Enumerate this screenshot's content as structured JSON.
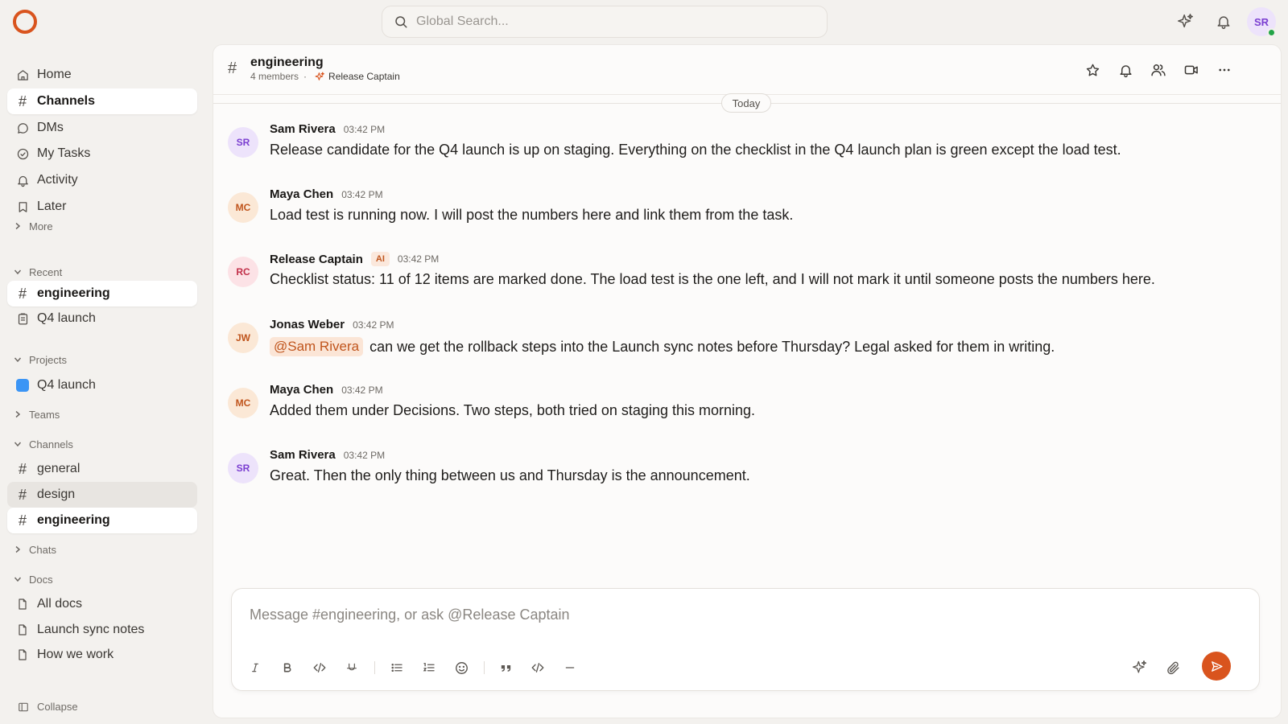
{
  "app": {
    "search_placeholder": "Global Search...",
    "user_initials": "SR",
    "accent": "#d9541e"
  },
  "sidebar": {
    "nav": [
      {
        "label": "Home",
        "icon": "home-icon"
      },
      {
        "label": "Channels",
        "icon": "hash-icon",
        "active": true
      },
      {
        "label": "DMs",
        "icon": "chat-bubble-icon"
      },
      {
        "label": "My Tasks",
        "icon": "check-circle-icon"
      },
      {
        "label": "Activity",
        "icon": "bell-icon"
      },
      {
        "label": "Later",
        "icon": "bookmark-icon"
      }
    ],
    "more_label": "More",
    "recent_label": "Recent",
    "recent": [
      {
        "label": "engineering",
        "icon": "hash-icon",
        "active": true
      },
      {
        "label": "Q4 launch",
        "icon": "clipboard-icon"
      }
    ],
    "projects_label": "Projects",
    "projects": [
      {
        "label": "Q4 launch",
        "color": "#3b95f5"
      }
    ],
    "teams_label": "Teams",
    "channels_label": "Channels",
    "channels": [
      {
        "label": "general"
      },
      {
        "label": "design",
        "hover": true
      },
      {
        "label": "engineering",
        "active": true
      }
    ],
    "chats_label": "Chats",
    "docs_label": "Docs",
    "docs": [
      {
        "label": "All docs"
      },
      {
        "label": "Launch sync notes"
      },
      {
        "label": "How we work"
      }
    ],
    "collapse_label": "Collapse"
  },
  "channel": {
    "name": "engineering",
    "members": "4 members",
    "agent": "Release Captain",
    "day_divider": "Today"
  },
  "messages": [
    {
      "initials": "SR",
      "author": "Sam Rivera",
      "time": "03:42 PM",
      "text": "Release candidate for the Q4 launch is up on staging. Everything on the checklist in the Q4 launch plan is green except the load test.",
      "av_bg": "#ede3fb",
      "av_fg": "#7b3fd1"
    },
    {
      "initials": "MC",
      "author": "Maya Chen",
      "time": "03:42 PM",
      "text": "Load test is running now. I will post the numbers here and link them from the task.",
      "av_bg": "#fbe8d6",
      "av_fg": "#c0551d"
    },
    {
      "initials": "RC",
      "author": "Release Captain",
      "badge": "AI",
      "time": "03:42 PM",
      "text": "Checklist status: 11 of 12 items are marked done. The load test is the one left, and I will not mark it until someone posts the numbers here.",
      "av_bg": "#fce2e6",
      "av_fg": "#c2304a"
    },
    {
      "initials": "JW",
      "author": "Jonas Weber",
      "time": "03:42 PM",
      "mention": "@Sam Rivera",
      "text": "can we get the rollback steps into the Launch sync notes before Thursday? Legal asked for them in writing.",
      "av_bg": "#fbe8d6",
      "av_fg": "#c0551d"
    },
    {
      "initials": "MC",
      "author": "Maya Chen",
      "time": "03:42 PM",
      "text": "Added them under Decisions. Two steps, both tried on staging this morning.",
      "av_bg": "#fbe8d6",
      "av_fg": "#c0551d"
    },
    {
      "initials": "SR",
      "author": "Sam Rivera",
      "time": "03:42 PM",
      "text": "Great. Then the only thing between us and Thursday is the announcement.",
      "av_bg": "#ede3fb",
      "av_fg": "#7b3fd1"
    }
  ],
  "composer": {
    "placeholder": "Message #engineering, or ask @Release Captain"
  }
}
